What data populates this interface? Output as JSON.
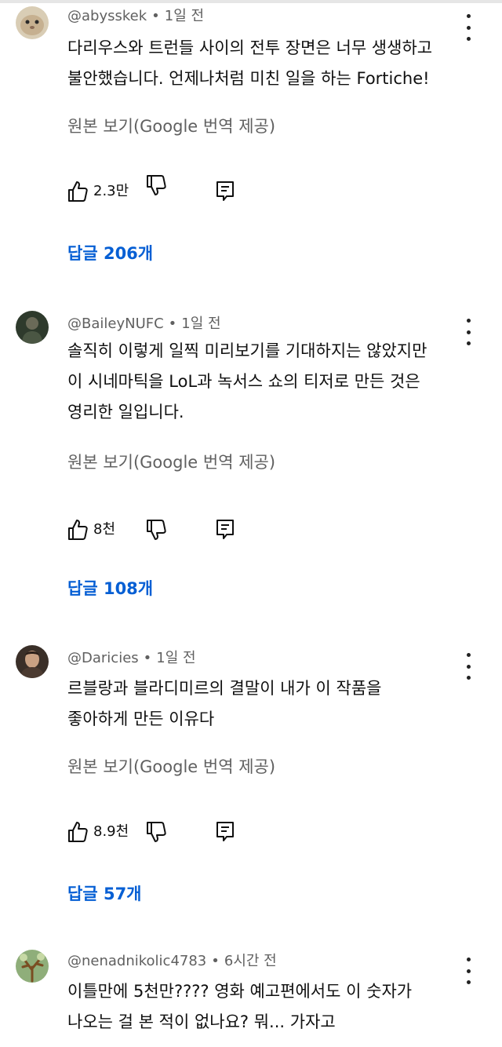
{
  "comments": [
    {
      "author": "@abysskek",
      "time": "1일 전",
      "lines": [
        "다리우스와 트런들 사이의 전투 장면은 너무 생생하고",
        "불안했습니다. 언제나처럼 미친 일을 하는 Fortiche!"
      ],
      "translate_label": "원본 보기(Google 번역 제공)",
      "likes": "2.3만",
      "replies": "답글 206개",
      "avatar_color": "#d8c7a8"
    },
    {
      "author": "@BaileyNUFC",
      "time": "1일 전",
      "lines": [
        "솔직히 이렇게 일찍 미리보기를 기대하지는 않았지만",
        "이 시네마틱을 LoL과 녹서스 쇼의 티저로 만든 것은",
        "영리한 일입니다."
      ],
      "translate_label": "원본 보기(Google 번역 제공)",
      "likes": "8천",
      "replies": "답글 108개",
      "avatar_color": "#3d4a3a"
    },
    {
      "author": "@Daricies",
      "time": "1일 전",
      "lines": [
        "르블랑과 블라디미르의 결말이 내가 이 작품을",
        "좋아하게 만든 이유다"
      ],
      "translate_label": "원본 보기(Google 번역 제공)",
      "likes": "8.9천",
      "replies": "답글 57개",
      "avatar_color": "#5a4a3e"
    },
    {
      "author": "@nenadnikolic4783",
      "time": "6시간 전",
      "lines": [
        "이틀만에 5천만???? 영화 예고편에서도 이 숫자가",
        "나오는 걸 본 적이 없나요? 뭐... 가자고"
      ],
      "avatar_color": "#6f8a5a"
    }
  ]
}
